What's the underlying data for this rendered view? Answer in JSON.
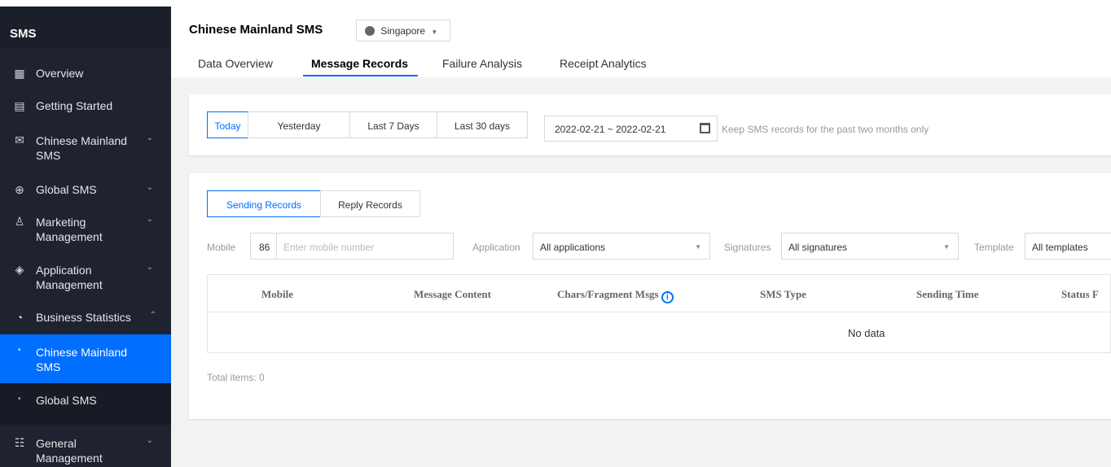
{
  "sidebar": {
    "title": "SMS",
    "items": [
      {
        "label": "Overview",
        "icon": "overview-grid-icon"
      },
      {
        "label": "Getting Started",
        "icon": "document-icon"
      },
      {
        "label": "Chinese Mainland SMS",
        "icon": "mail-icon"
      },
      {
        "label": "Global SMS",
        "icon": "globe-icon"
      },
      {
        "label": "Marketing Management",
        "icon": "users-icon"
      },
      {
        "label": "Application Management",
        "icon": "layers-icon"
      },
      {
        "label": "Business Statistics",
        "icon": "pie-chart-icon"
      },
      {
        "label": "General Management",
        "icon": "settings-sliders-icon"
      }
    ],
    "sub_items": [
      "Chinese Mainland SMS",
      "Global SMS"
    ],
    "active_color": "#006eff"
  },
  "header": {
    "title": "Chinese Mainland SMS",
    "region": "Singapore",
    "tabs": [
      "Data Overview",
      "Message Records",
      "Failure Analysis",
      "Receipt Analytics"
    ],
    "active_tab": "Message Records"
  },
  "date_filter": {
    "buttons": [
      "Today",
      "Yesterday",
      "Last 7 Days",
      "Last 30 days"
    ],
    "selected": "Today",
    "range": "2022-02-21 ~ 2022-02-21",
    "hint": "Keep SMS records for the past two months only"
  },
  "records": {
    "tabs": [
      "Sending Records",
      "Reply Records"
    ],
    "selected_tab": "Sending Records",
    "mobile_label": "Mobile",
    "country_code": "86",
    "mobile_placeholder": "Enter mobile number",
    "application_label": "Application",
    "application_value": "All applications",
    "signatures_label": "Signatures",
    "signatures_value": "All signatures",
    "template_label": "Template",
    "template_value": "All templates",
    "columns": [
      "Mobile",
      "Message Content",
      "Chars/Fragment Msgs",
      "SMS Type",
      "Sending Time",
      "Status F"
    ],
    "empty_text": "No data",
    "total": "Total items: 0"
  }
}
